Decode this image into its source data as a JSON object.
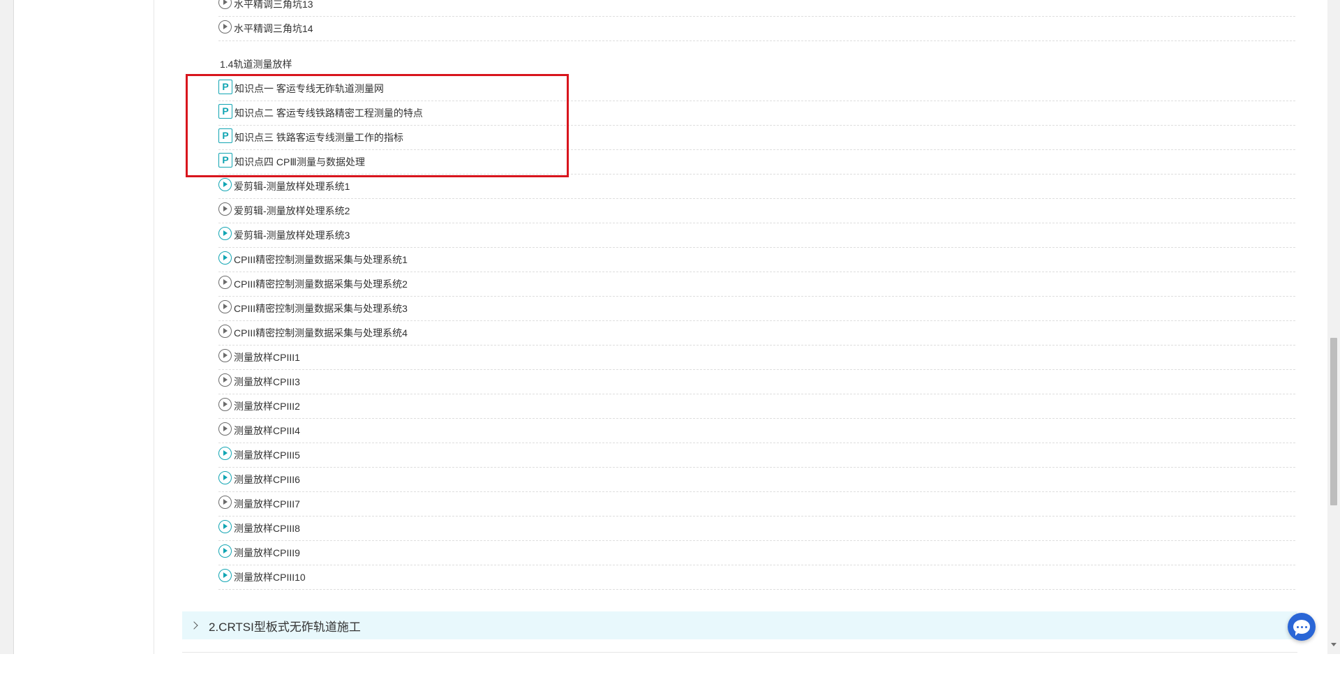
{
  "course_tree": {
    "items_top": [
      {
        "label": "水平精调三角坑13",
        "icon": "play-icon",
        "done": false
      },
      {
        "label": "水平精调三角坑14",
        "icon": "play-icon",
        "done": false
      }
    ],
    "section_title": "1.4轨道测量放样",
    "knowledge_points": [
      {
        "label": "知识点一 客运专线无砟轨道测量网",
        "icon": "p-doc-icon"
      },
      {
        "label": "知识点二 客运专线铁路精密工程测量的特点",
        "icon": "p-doc-icon"
      },
      {
        "label": "知识点三 铁路客运专线测量工作的指标",
        "icon": "p-doc-icon"
      },
      {
        "label": "知识点四 CPⅢ测量与数据处理",
        "icon": "p-doc-icon"
      }
    ],
    "videos": [
      {
        "label": "爱剪辑-测量放样处理系统1",
        "icon": "play-icon",
        "done": true
      },
      {
        "label": "爱剪辑-测量放样处理系统2",
        "icon": "play-icon",
        "done": false
      },
      {
        "label": "爱剪辑-测量放样处理系统3",
        "icon": "play-icon",
        "done": true
      },
      {
        "label": "CPIII精密控制测量数据采集与处理系统1",
        "icon": "play-icon",
        "done": true
      },
      {
        "label": "CPIII精密控制测量数据采集与处理系统2",
        "icon": "play-icon",
        "done": false
      },
      {
        "label": "CPIII精密控制测量数据采集与处理系统3",
        "icon": "play-icon",
        "done": false
      },
      {
        "label": "CPIII精密控制测量数据采集与处理系统4",
        "icon": "play-icon",
        "done": false
      },
      {
        "label": "测量放样CPIII1",
        "icon": "play-icon",
        "done": false
      },
      {
        "label": "测量放样CPIII3",
        "icon": "play-icon",
        "done": false
      },
      {
        "label": "测量放样CPIII2",
        "icon": "play-icon",
        "done": false
      },
      {
        "label": "测量放样CPIII4",
        "icon": "play-icon",
        "done": false
      },
      {
        "label": "测量放样CPIII5",
        "icon": "play-icon",
        "done": true
      },
      {
        "label": "测量放样CPIII6",
        "icon": "play-icon",
        "done": true
      },
      {
        "label": "测量放样CPIII7",
        "icon": "play-icon",
        "done": false
      },
      {
        "label": "测量放样CPIII8",
        "icon": "play-icon",
        "done": true
      },
      {
        "label": "测量放样CPIII9",
        "icon": "play-icon",
        "done": true
      },
      {
        "label": "测量放样CPIII10",
        "icon": "play-icon",
        "done": true
      }
    ]
  },
  "chapter_bar": {
    "label": "2.CRTSI型板式无砟轨道施工",
    "icon": "chevron-right-icon"
  },
  "chat_button": {
    "icon": "chat-bubble-icon"
  },
  "colors": {
    "accent": "#12a5b3",
    "highlight_box": "#d8151d",
    "chapter_bg": "#e8f8fc",
    "chat_button": "#2a66d6"
  }
}
